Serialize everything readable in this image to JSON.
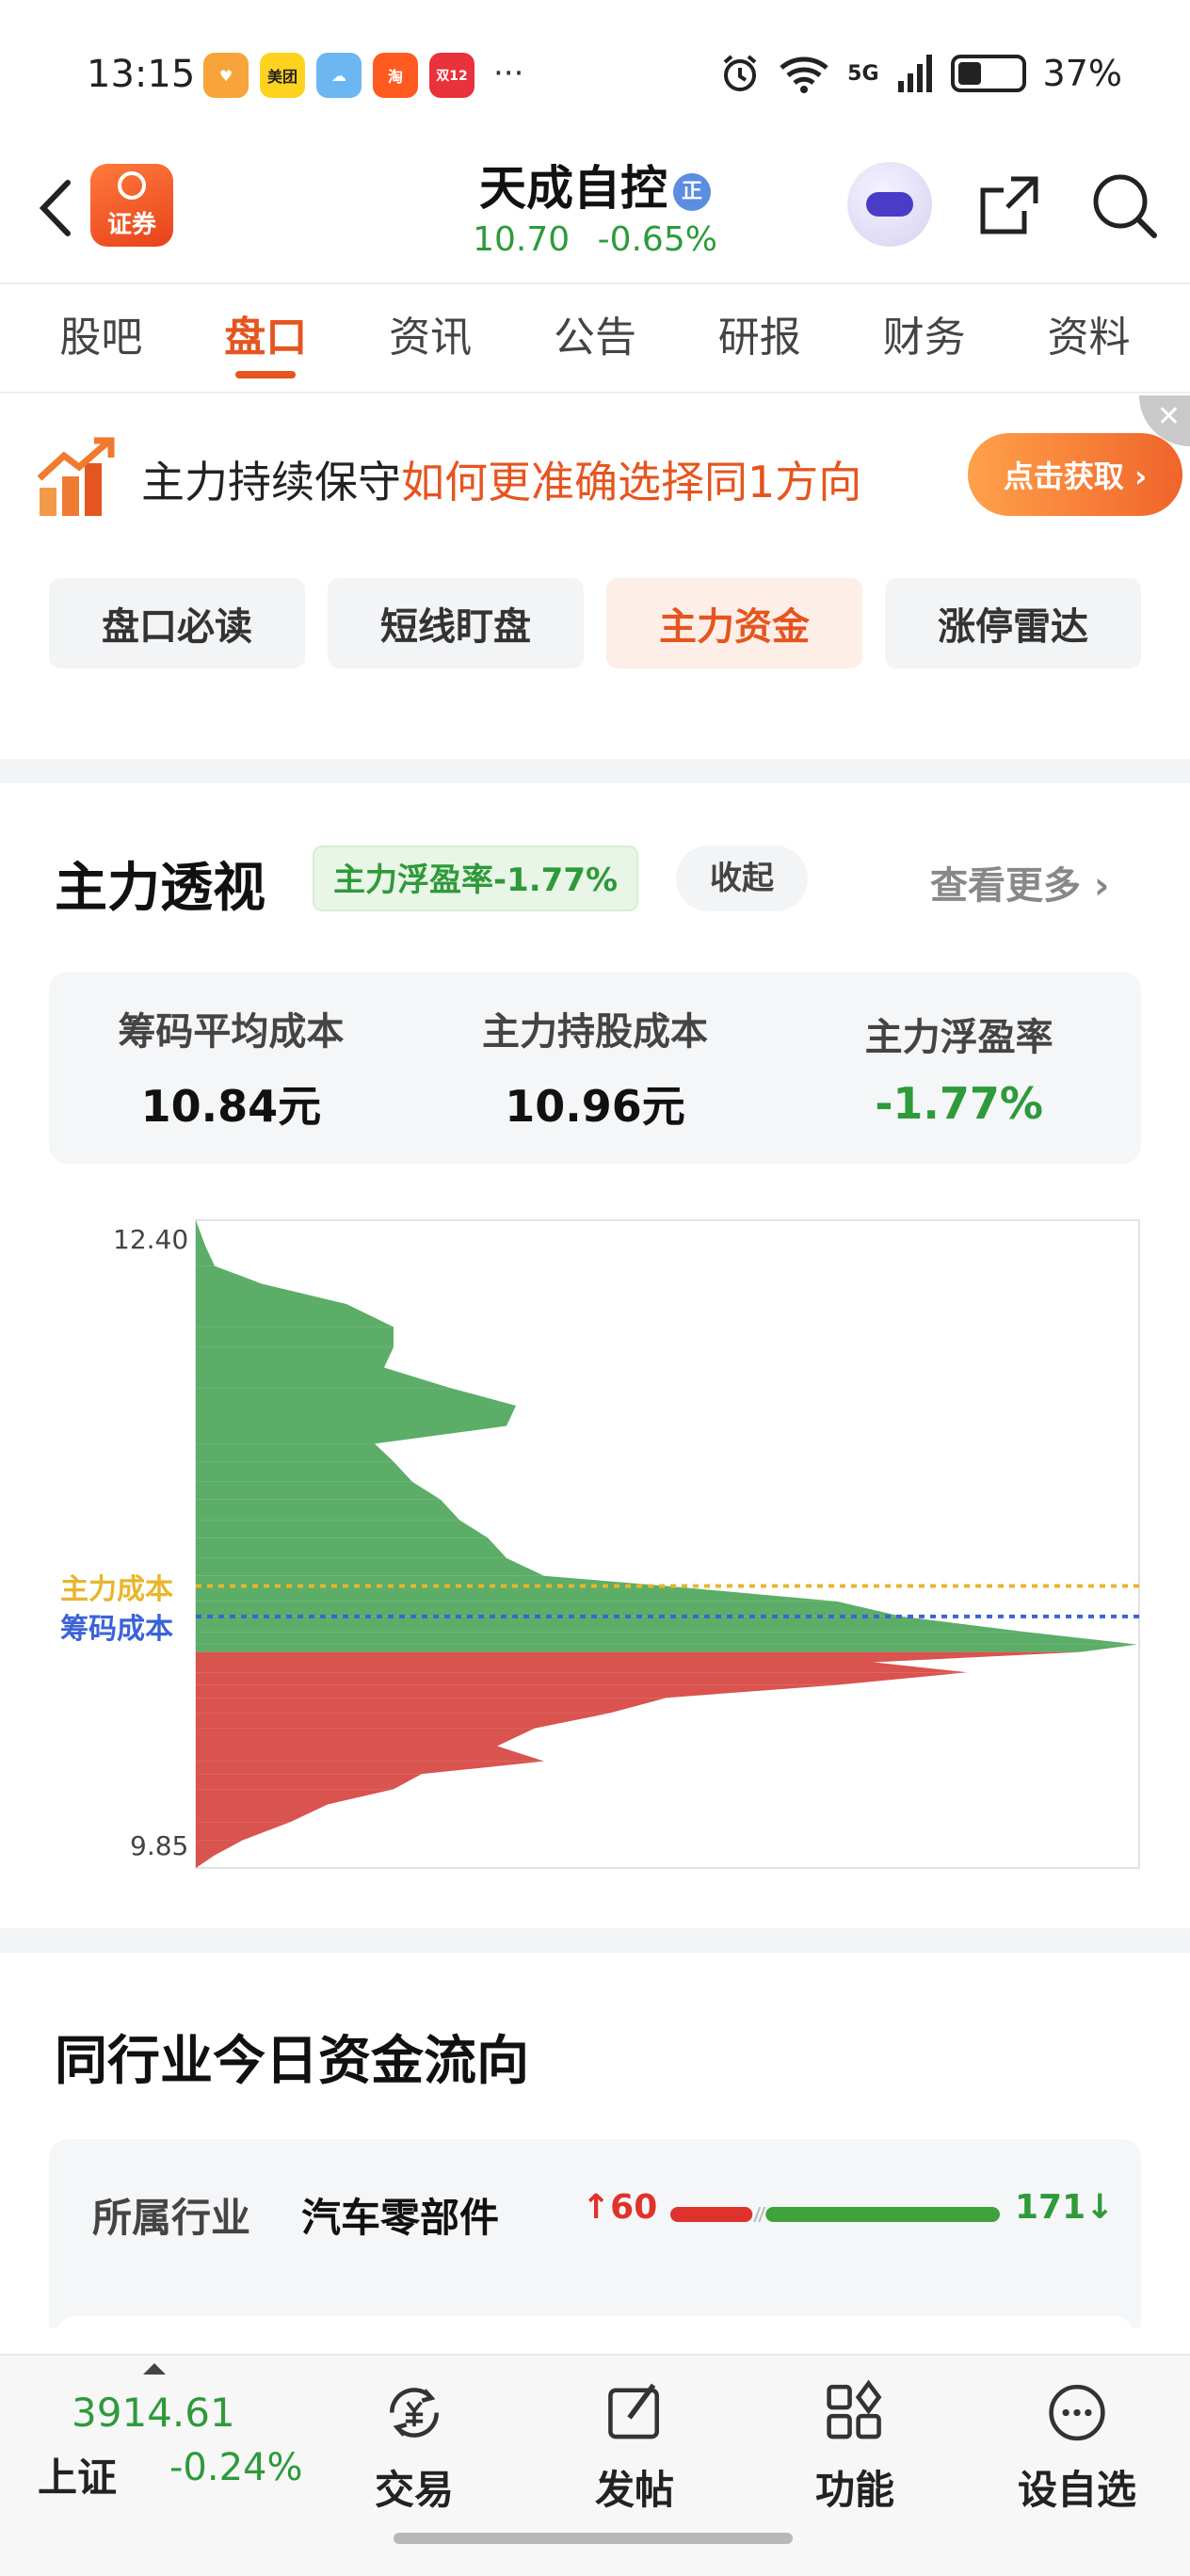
{
  "status_bar": {
    "time": "13:15",
    "apps": [
      {
        "name": "heart-app",
        "label": "♥",
        "color": "#f7a43a"
      },
      {
        "name": "meituan-app",
        "label": "美团",
        "color": "#ffd21f"
      },
      {
        "name": "weather-app",
        "label": "☁",
        "color": "#6cb6f2"
      },
      {
        "name": "taobao-app",
        "label": "淘",
        "color": "#ff5a1f"
      },
      {
        "name": "double12-app",
        "label": "双12",
        "color": "#e9323b"
      }
    ],
    "more": "···",
    "network": "5G",
    "battery": "37%",
    "battery_level": 0.37
  },
  "header": {
    "app_logo_label": "证券",
    "stock_name": "天成自控",
    "stock_badge": "正",
    "price": "10.70",
    "change": "-0.65%"
  },
  "tabs": [
    {
      "label": "股吧",
      "active": false
    },
    {
      "label": "盘口",
      "active": true
    },
    {
      "label": "资讯",
      "active": false
    },
    {
      "label": "公告",
      "active": false
    },
    {
      "label": "研报",
      "active": false
    },
    {
      "label": "财务",
      "active": false
    },
    {
      "label": "资料",
      "active": false
    }
  ],
  "banner": {
    "text": "主力持续保守",
    "highlight": "如何更准确选择同1方向",
    "button": "点击获取 ›",
    "close": "✕"
  },
  "subtabs": [
    {
      "label": "盘口必读",
      "active": false
    },
    {
      "label": "短线盯盘",
      "active": false
    },
    {
      "label": "主力资金",
      "active": true
    },
    {
      "label": "涨停雷达",
      "active": false
    }
  ],
  "main_force": {
    "title": "主力透视",
    "badge": "主力浮盈率-1.77%",
    "collapse": "收起",
    "more": "查看更多 ›",
    "stats": [
      {
        "label": "筹码平均成本",
        "value": "10.84元"
      },
      {
        "label": "主力持股成本",
        "value": "10.96元"
      },
      {
        "label": "主力浮盈率",
        "value": "-1.77%"
      }
    ]
  },
  "chart_data": {
    "type": "area",
    "orientation": "horizontal-chip-distribution",
    "title": "",
    "y_top_label": "12.40",
    "y_bottom_label": "9.85",
    "ylim": [
      9.85,
      12.4
    ],
    "current_price": 10.7,
    "lines": [
      {
        "label": "主力成本",
        "price": 10.96,
        "color": "#e8b52c"
      },
      {
        "label": "筹码成本",
        "price": 10.84,
        "color": "#3b63d6"
      }
    ],
    "colors": {
      "above_price": "#5cad68",
      "below_price": "#d9534f"
    },
    "profile": [
      {
        "price": 12.4,
        "weight": 0.0
      },
      {
        "price": 12.3,
        "weight": 0.01
      },
      {
        "price": 12.22,
        "weight": 0.02
      },
      {
        "price": 12.15,
        "weight": 0.07
      },
      {
        "price": 12.07,
        "weight": 0.16
      },
      {
        "price": 11.98,
        "weight": 0.21
      },
      {
        "price": 11.9,
        "weight": 0.21
      },
      {
        "price": 11.82,
        "weight": 0.2
      },
      {
        "price": 11.74,
        "weight": 0.27
      },
      {
        "price": 11.67,
        "weight": 0.34
      },
      {
        "price": 11.59,
        "weight": 0.33
      },
      {
        "price": 11.52,
        "weight": 0.19
      },
      {
        "price": 11.45,
        "weight": 0.21
      },
      {
        "price": 11.37,
        "weight": 0.23
      },
      {
        "price": 11.3,
        "weight": 0.26
      },
      {
        "price": 11.22,
        "weight": 0.28
      },
      {
        "price": 11.15,
        "weight": 0.31
      },
      {
        "price": 11.07,
        "weight": 0.33
      },
      {
        "price": 11.0,
        "weight": 0.37
      },
      {
        "price": 10.96,
        "weight": 0.5
      },
      {
        "price": 10.9,
        "weight": 0.68
      },
      {
        "price": 10.84,
        "weight": 0.75
      },
      {
        "price": 10.78,
        "weight": 0.88
      },
      {
        "price": 10.73,
        "weight": 1.0
      },
      {
        "price": 10.7,
        "weight": 0.94
      },
      {
        "price": 10.66,
        "weight": 0.72
      },
      {
        "price": 10.62,
        "weight": 0.82
      },
      {
        "price": 10.57,
        "weight": 0.68
      },
      {
        "price": 10.52,
        "weight": 0.5
      },
      {
        "price": 10.46,
        "weight": 0.44
      },
      {
        "price": 10.4,
        "weight": 0.36
      },
      {
        "price": 10.33,
        "weight": 0.32
      },
      {
        "price": 10.27,
        "weight": 0.37
      },
      {
        "price": 10.22,
        "weight": 0.24
      },
      {
        "price": 10.16,
        "weight": 0.21
      },
      {
        "price": 10.1,
        "weight": 0.14
      },
      {
        "price": 10.03,
        "weight": 0.1
      },
      {
        "price": 9.96,
        "weight": 0.05
      },
      {
        "price": 9.9,
        "weight": 0.02
      },
      {
        "price": 9.85,
        "weight": 0.0
      }
    ]
  },
  "industry": {
    "title": "同行业今日资金流向",
    "label": "所属行业",
    "name": "汽车零部件",
    "up_count": "60",
    "down_count": "171",
    "up": 60,
    "down": 171
  },
  "bottom_nav": {
    "index_value": "3914.61",
    "index_name": "上证",
    "index_change": "-0.24%",
    "items": [
      {
        "label": "交易",
        "icon": "yuan-exchange-icon"
      },
      {
        "label": "发帖",
        "icon": "edit-post-icon"
      },
      {
        "label": "功能",
        "icon": "grid-apps-icon"
      },
      {
        "label": "设自选",
        "icon": "more-dots-icon"
      }
    ]
  }
}
